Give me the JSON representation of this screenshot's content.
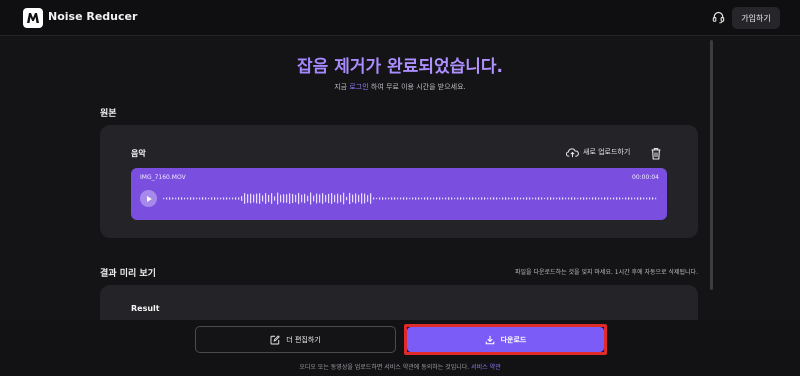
{
  "app": {
    "name": "Noise Reducer",
    "logo_text": "M"
  },
  "header": {
    "signup_label": "가입하기",
    "support_icon": "headset-icon"
  },
  "hero": {
    "title": "잡음 제거가 완료되었습니다.",
    "subtitle_prefix": "지금",
    "subtitle_link": "로그인",
    "subtitle_suffix": "하여 무료 이용 시간을 받으세요."
  },
  "original": {
    "section_label": "원본",
    "card_title": "음악",
    "upload_label": "새로 업로드하기",
    "file_name": "IMG_7160.MOV",
    "duration": "00:00:04",
    "accent_color": "#7a4fe0"
  },
  "preview": {
    "section_label": "결과 미리 보기",
    "notice": "파일을 다운로드하는 것을 잊지 마세요. 1시간 후에 자동으로 삭제됩니다.",
    "result_title": "Result"
  },
  "actions": {
    "edit_label": "더 편집하기",
    "download_label": "다운로드",
    "download_color": "#7c5cf7",
    "highlight_color": "#e12a2a"
  },
  "footer": {
    "terms_prefix": "오디오 또는 동영상을 업로드하면 서비스 약관에 동의하는 것입니다.",
    "terms_link": "서비스 약관"
  }
}
